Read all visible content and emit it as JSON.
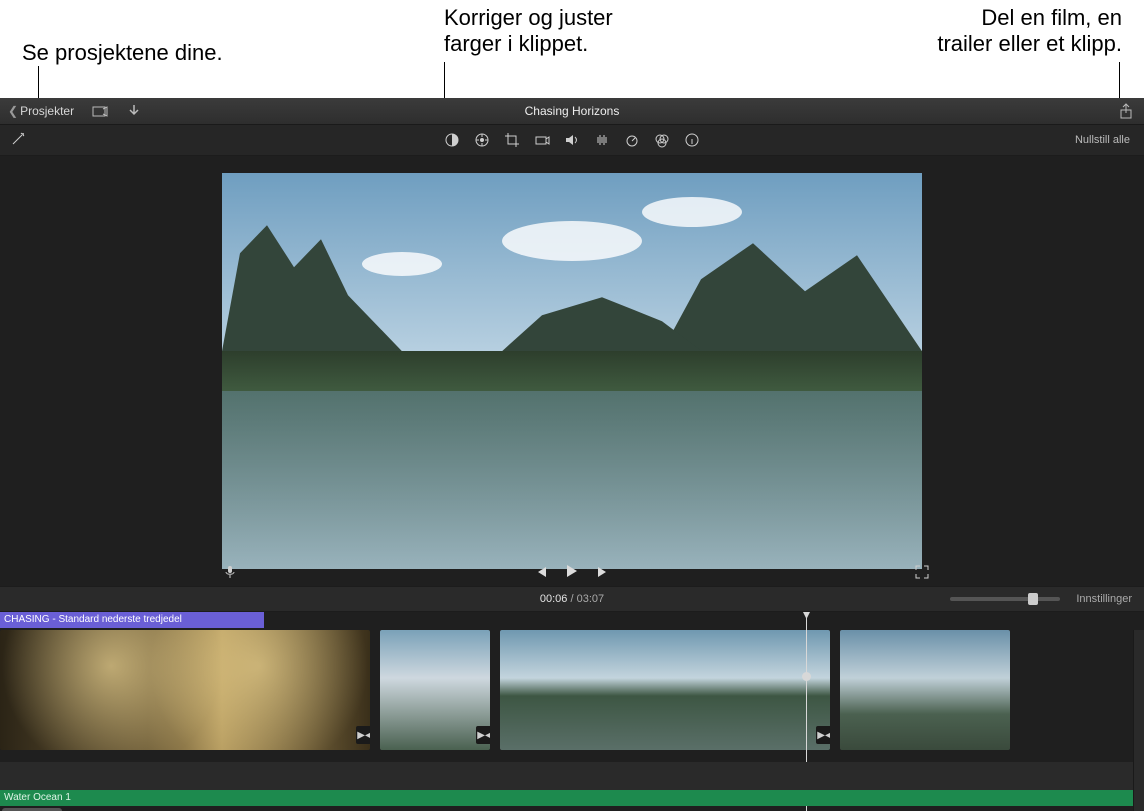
{
  "callouts": {
    "projects": "Se prosjektene dine.",
    "color": "Korriger og juster\nfarger i klippet.",
    "share": "Del en film, en\ntrailer eller et klipp."
  },
  "titlebar": {
    "back_label": "Prosjekter",
    "project_title": "Chasing Horizons"
  },
  "adjust": {
    "reset_label": "Nullstill alle",
    "icons": [
      "wand-icon",
      "color-balance-icon",
      "color-wheel-icon",
      "crop-icon",
      "stabilize-icon",
      "volume-icon",
      "noise-reduction-icon",
      "speed-icon",
      "filters-icon",
      "info-icon"
    ]
  },
  "viewer": {
    "mic_label": "mic",
    "prev_label": "previous",
    "play_label": "play",
    "next_label": "next",
    "fullscreen_label": "fullscreen"
  },
  "time": {
    "current": "00:06",
    "sep": " / ",
    "total": "03:07",
    "settings_label": "Innstillinger"
  },
  "timeline": {
    "title_clip_label": "CHASING - Standard nederste tredjedel",
    "audio_label": "Water Ocean 1",
    "playhead_pct": 70
  }
}
